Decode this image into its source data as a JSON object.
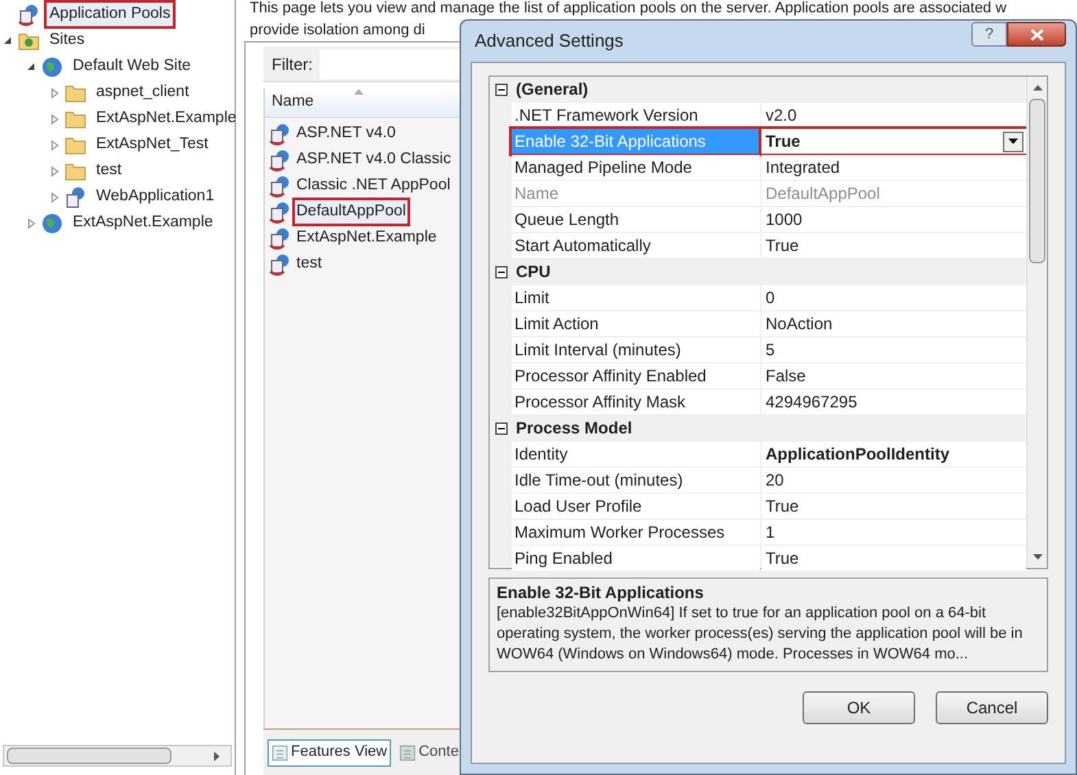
{
  "tree": [
    {
      "label": "Application Pools",
      "kind": "pool",
      "selected": true
    },
    {
      "label": "Sites",
      "kind": "sites",
      "selected": false,
      "expanded": true,
      "children": [
        {
          "label": "Default Web Site",
          "kind": "globe",
          "selected": false,
          "expanded": true,
          "children": [
            {
              "label": "aspnet_client",
              "kind": "folder",
              "selected": false,
              "expanded": false
            },
            {
              "label": "ExtAspNet.Example",
              "kind": "folder",
              "selected": false,
              "expanded": false
            },
            {
              "label": "ExtAspNet_Test",
              "kind": "folder",
              "selected": false,
              "expanded": false
            },
            {
              "label": "test",
              "kind": "folder",
              "selected": false,
              "expanded": false
            },
            {
              "label": "WebApplication1",
              "kind": "app",
              "selected": false,
              "expanded": false
            }
          ]
        },
        {
          "label": "ExtAspNet.Example",
          "kind": "globe",
          "selected": false,
          "expanded": false
        }
      ]
    }
  ],
  "page": {
    "description_line_1": "This page lets you view and manage the list of application pools on the server. Application pools are associated w",
    "description_line_2": "provide isolation among di",
    "filter_label": "Filter:",
    "column": "Name",
    "pools": [
      {
        "name": "ASP.NET v4.0",
        "selected": false
      },
      {
        "name": "ASP.NET v4.0 Classic",
        "selected": false
      },
      {
        "name": "Classic .NET AppPool",
        "selected": false
      },
      {
        "name": "DefaultAppPool",
        "selected": true
      },
      {
        "name": "ExtAspNet.Example",
        "selected": false
      },
      {
        "name": "test",
        "selected": false
      }
    ],
    "view_tabs": [
      {
        "label": "Features View",
        "selected": true
      },
      {
        "label": "Conte",
        "selected": false
      }
    ]
  },
  "dialog": {
    "title": "Advanced Settings",
    "help": "?",
    "rows": [
      {
        "kind": "category",
        "name": "(General)",
        "expanded": true
      },
      {
        "kind": "property",
        "name": ".NET Framework Version",
        "value": "v2.0",
        "modified": false,
        "disabled": false,
        "selected": false
      },
      {
        "kind": "property",
        "name": "Enable 32-Bit Applications",
        "value": "True",
        "modified": true,
        "disabled": false,
        "selected": true
      },
      {
        "kind": "property",
        "name": "Managed Pipeline Mode",
        "value": "Integrated",
        "modified": false,
        "disabled": false,
        "selected": false
      },
      {
        "kind": "property",
        "name": "Name",
        "value": "DefaultAppPool",
        "modified": false,
        "disabled": true,
        "selected": false
      },
      {
        "kind": "property",
        "name": "Queue Length",
        "value": "1000",
        "modified": false,
        "disabled": false,
        "selected": false
      },
      {
        "kind": "property",
        "name": "Start Automatically",
        "value": "True",
        "modified": false,
        "disabled": false,
        "selected": false
      },
      {
        "kind": "category",
        "name": "CPU",
        "expanded": true
      },
      {
        "kind": "property",
        "name": "Limit",
        "value": "0",
        "modified": false,
        "disabled": false,
        "selected": false
      },
      {
        "kind": "property",
        "name": "Limit Action",
        "value": "NoAction",
        "modified": false,
        "disabled": false,
        "selected": false
      },
      {
        "kind": "property",
        "name": "Limit Interval (minutes)",
        "value": "5",
        "modified": false,
        "disabled": false,
        "selected": false
      },
      {
        "kind": "property",
        "name": "Processor Affinity Enabled",
        "value": "False",
        "modified": false,
        "disabled": false,
        "selected": false
      },
      {
        "kind": "property",
        "name": "Processor Affinity Mask",
        "value": "4294967295",
        "modified": false,
        "disabled": false,
        "selected": false
      },
      {
        "kind": "category",
        "name": "Process Model",
        "expanded": true
      },
      {
        "kind": "property",
        "name": "Identity",
        "value": "ApplicationPoolIdentity",
        "modified": true,
        "disabled": false,
        "selected": false
      },
      {
        "kind": "property",
        "name": "Idle Time-out (minutes)",
        "value": "20",
        "modified": false,
        "disabled": false,
        "selected": false
      },
      {
        "kind": "property",
        "name": "Load User Profile",
        "value": "True",
        "modified": false,
        "disabled": false,
        "selected": false
      },
      {
        "kind": "property",
        "name": "Maximum Worker Processes",
        "value": "1",
        "modified": false,
        "disabled": false,
        "selected": false
      },
      {
        "kind": "property",
        "name": "Ping Enabled",
        "value": "True",
        "modified": false,
        "disabled": false,
        "selected": false
      }
    ],
    "help_title": "Enable 32-Bit Applications",
    "help_text": "[enable32BitAppOnWin64] If set to true for an application pool on a 64-bit operating system, the worker process(es) serving the application pool will be in WOW64 (Windows on Windows64) mode. Processes in WOW64 mo...",
    "buttons": [
      "OK",
      "Cancel"
    ]
  }
}
